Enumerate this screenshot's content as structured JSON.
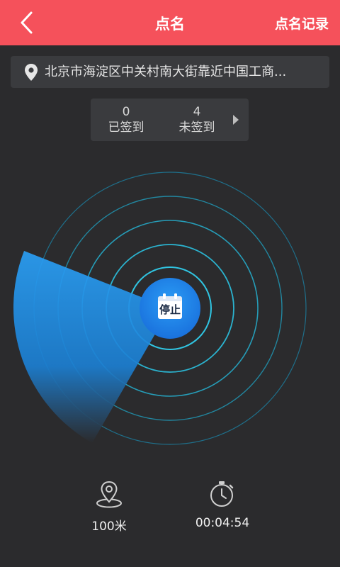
{
  "header": {
    "title": "点名",
    "records_label": "点名记录",
    "bg_color": "#f5515b"
  },
  "location": {
    "address": "北京市海淀区中关村南大街靠近中国工商..."
  },
  "stats": {
    "signed_count": "0",
    "signed_label": "已签到",
    "unsigned_count": "4",
    "unsigned_label": "未签到"
  },
  "radar": {
    "stop_label": "停止",
    "accent_color": "#1e8ee8"
  },
  "footer": {
    "distance": "100米",
    "elapsed_time": "00:04:54"
  },
  "icons": [
    "back-arrow-icon",
    "location-pin-icon",
    "chevron-right-icon",
    "calendar-icon",
    "map-pin-distance-icon",
    "stopwatch-icon"
  ]
}
